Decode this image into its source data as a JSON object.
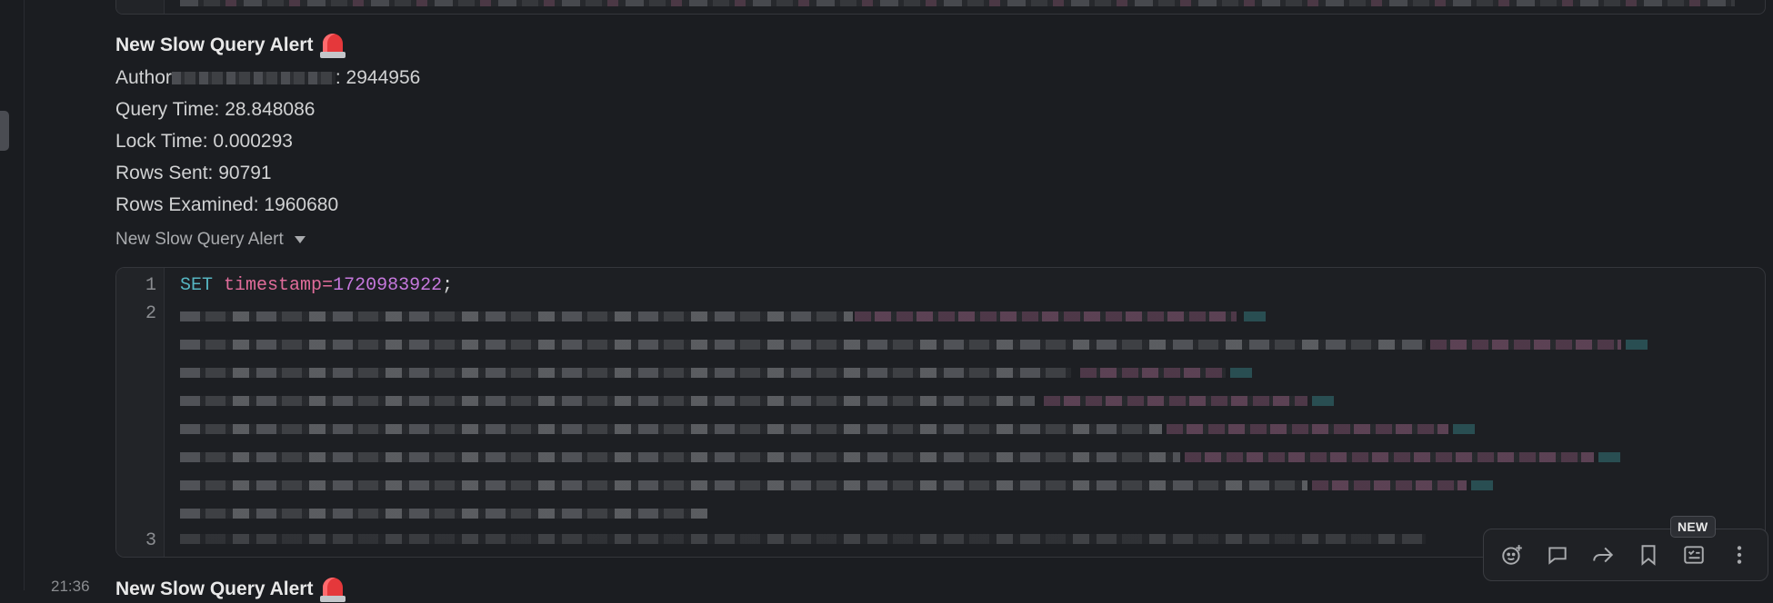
{
  "message": {
    "title": "New Slow Query Alert",
    "author_label": "Author",
    "author_value": ": 2944956",
    "query_time": "Query Time: 28.848086",
    "lock_time": "Lock Time: 0.000293",
    "rows_sent": "Rows Sent: 90791",
    "rows_examined": "Rows Examined: 1960680",
    "collapse_label": "New Slow Query Alert"
  },
  "code": {
    "line_numbers": [
      "1",
      "2",
      "3"
    ],
    "line1": {
      "keyword": "SET",
      "variable": "timestamp",
      "operator": "=",
      "value": "1720983922",
      "terminator": ";"
    }
  },
  "next_message": {
    "timestamp_prefix": "21:36",
    "title": "New Slow Query Alert"
  },
  "toolbar": {
    "badge": "NEW",
    "icons": [
      "emoji-reaction-icon",
      "reply-in-thread-icon",
      "forward-icon",
      "bookmark-icon",
      "add-to-list-icon",
      "more-actions-icon"
    ]
  }
}
